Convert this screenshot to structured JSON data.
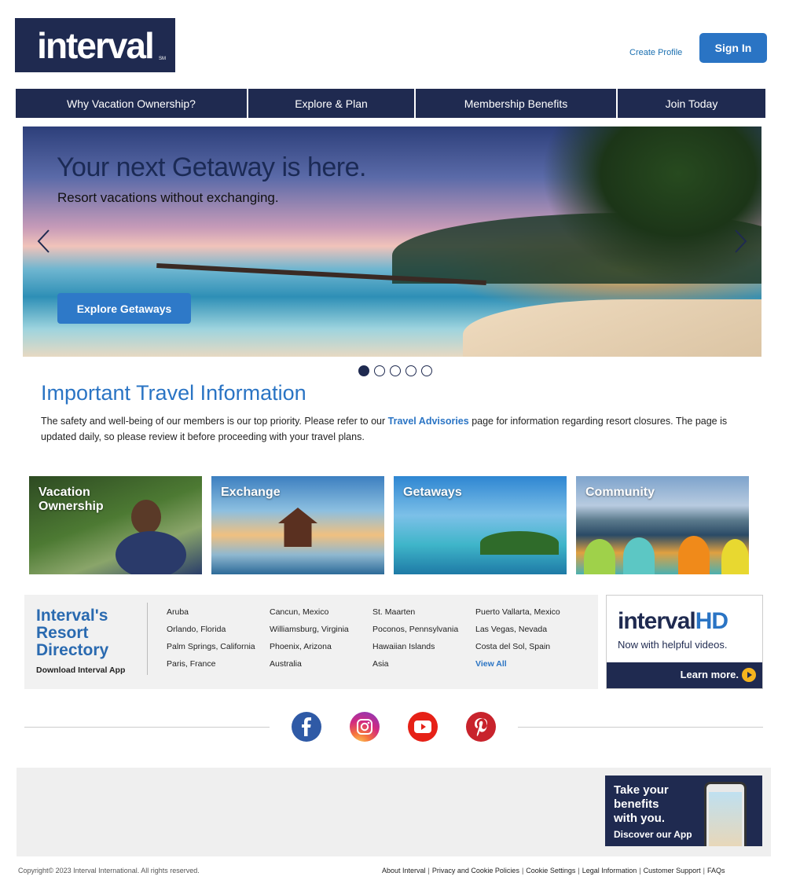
{
  "header": {
    "logo_text": "interval",
    "logo_mark": "SM",
    "create_profile": "Create Profile",
    "sign_in": "Sign In"
  },
  "nav": [
    {
      "label": "Why Vacation Ownership?"
    },
    {
      "label": "Explore & Plan"
    },
    {
      "label": "Membership Benefits"
    },
    {
      "label": "Join Today"
    }
  ],
  "hero": {
    "title": "Your next Getaway is here.",
    "subtitle": "Resort vacations without exchanging.",
    "button": "Explore Getaways",
    "slide_count": 5,
    "active_slide": 1
  },
  "info": {
    "title": "Important Travel Information",
    "text_before": "The safety and well-being of our members is our top priority. Please refer to our ",
    "link": "Travel Advisories",
    "text_after": " page for information regarding resort closures. The page is updated daily, so please review it before proceeding with your travel plans."
  },
  "tiles": [
    {
      "label_line1": "Vacation",
      "label_line2": "Ownership"
    },
    {
      "label_line1": "Exchange",
      "label_line2": ""
    },
    {
      "label_line1": "Getaways",
      "label_line2": ""
    },
    {
      "label_line1": "Community",
      "label_line2": ""
    }
  ],
  "directory": {
    "title_line1": "Interval's",
    "title_line2": "Resort",
    "title_line3": "Directory",
    "app_link": "Download Interval App",
    "columns": [
      [
        "Aruba",
        "Orlando, Florida",
        "Palm Springs, California",
        "Paris, France"
      ],
      [
        "Cancun, Mexico",
        "Williamsburg, Virginia",
        "Phoenix, Arizona",
        "Australia"
      ],
      [
        "St. Maarten",
        "Poconos, Pennsylvania",
        "Hawaiian Islands",
        "Asia"
      ],
      [
        "Puerto Vallarta, Mexico",
        "Las Vegas, Nevada",
        "Costa del Sol, Spain"
      ]
    ],
    "view_all": "View All"
  },
  "interval_hd": {
    "logo_main": "interval",
    "logo_accent": "HD",
    "tagline": "Now with helpful videos.",
    "cta": "Learn more."
  },
  "social": [
    "facebook-icon",
    "instagram-icon",
    "youtube-icon",
    "pinterest-icon"
  ],
  "app_promo": {
    "line1": "Take your",
    "line2": "benefits",
    "line3": "with you.",
    "cta": "Discover our App"
  },
  "footer": {
    "copyright": "Copyright© 2023 Interval International. All rights reserved.",
    "links": [
      "About Interval",
      "Privacy and Cookie Policies",
      "Cookie Settings",
      "Legal Information",
      "Customer Support",
      "FAQs"
    ]
  },
  "colors": {
    "navy": "#1f2a50",
    "accent_blue": "#2a74c4"
  }
}
